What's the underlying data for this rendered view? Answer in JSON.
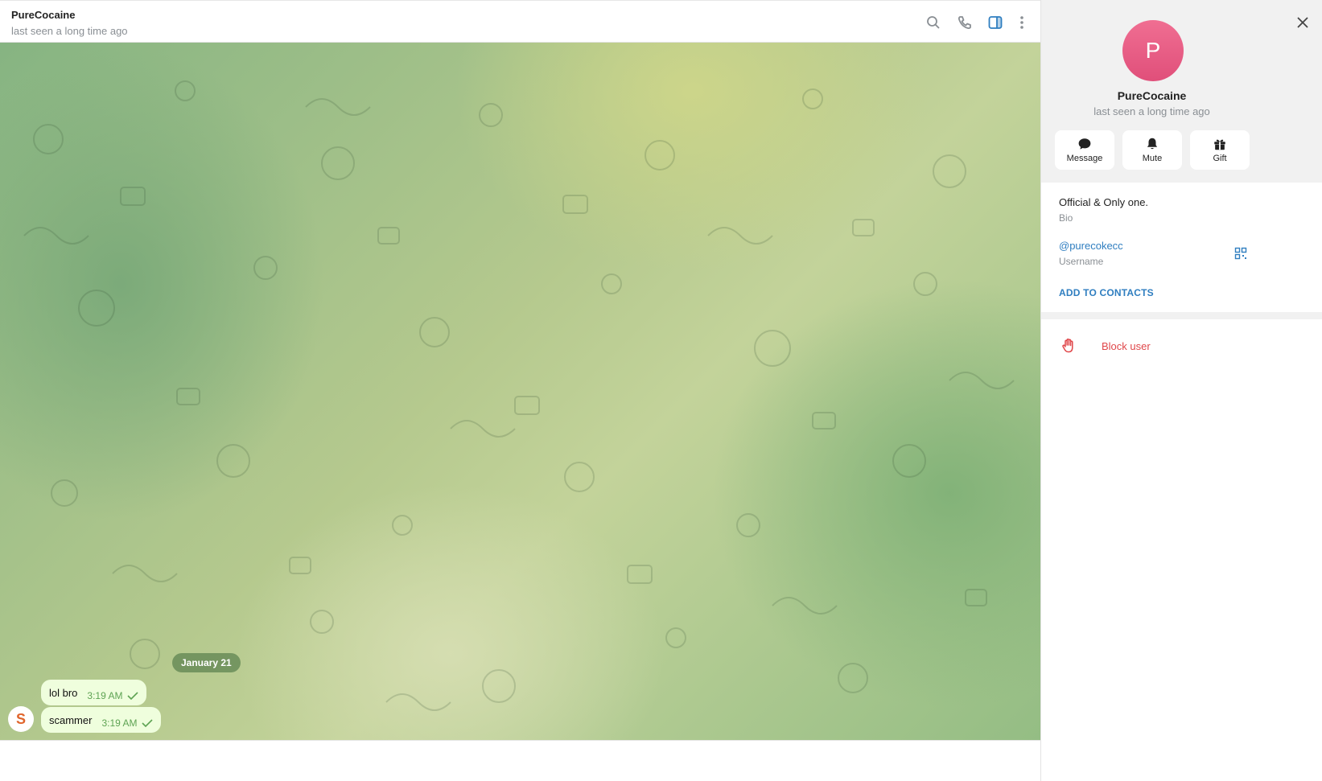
{
  "chat": {
    "title": "PureCocaine",
    "status": "last seen a long time ago",
    "date_chip": "January 21",
    "messages": [
      {
        "text": "lol bro",
        "time": "3:19 AM"
      },
      {
        "text": "scammer",
        "time": "3:19 AM"
      }
    ],
    "sender_avatar_letter": "S"
  },
  "header_icons": [
    "search-icon",
    "phone-icon",
    "sidebar-toggle-icon",
    "more-vertical-icon"
  ],
  "profile": {
    "avatar_letter": "P",
    "name": "PureCocaine",
    "status": "last seen a long time ago",
    "actions": [
      {
        "label": "Message",
        "icon": "message-icon"
      },
      {
        "label": "Mute",
        "icon": "bell-icon"
      },
      {
        "label": "Gift",
        "icon": "gift-icon"
      }
    ],
    "bio": "Official & Only one.",
    "bio_label": "Bio",
    "username": "@purecokecc",
    "username_label": "Username",
    "add_contacts": "ADD TO CONTACTS",
    "block": "Block user"
  },
  "colors": {
    "accent": "#2f7ec0",
    "danger": "#e0474a",
    "bubble": "#effedd",
    "avatar": "#e95b82"
  }
}
